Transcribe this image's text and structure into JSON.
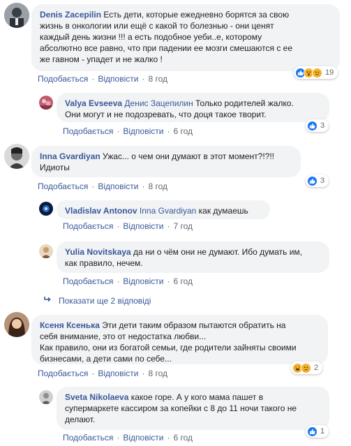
{
  "comments": [
    {
      "author": "Denis Zacepilin",
      "lines": [
        "Есть дети, которые ежедневно борятся за свою",
        "жизнь в онкологии или ещё с какой то болезнью - они ценят",
        "каждый день жизни !!! а есть подобное уеби..е, которому",
        "абсолютно все равно, что при падении ее мозги смешаются с ее",
        "же гавном - упадет и не жалко !"
      ],
      "like": "Подобається",
      "reply": "Відповісти",
      "time": "8 год",
      "reaction_count": "19"
    },
    {
      "author": "Valya Evseeva",
      "mention": "Денис Зацепилин",
      "lines": [
        " Только родителей жалко.",
        "Они могут и не подозревать, что доця такое творит."
      ],
      "like": "Подобається",
      "reply": "Відповісти",
      "time": "6 год",
      "reaction_count": "3"
    },
    {
      "author": "Inna Gvardiyan",
      "lines": [
        " Ужас... о чем они думают в этот момент?!?!!",
        "Идиоты"
      ],
      "like": "Подобається",
      "reply": "Відповісти",
      "time": "8 год",
      "reaction_count": "3"
    },
    {
      "author": "Vladislav Antonov",
      "mention": "Inna Gvardiyan",
      "lines": [
        " как думаешь"
      ],
      "like": "Подобається",
      "reply": "Відповісти",
      "time": "7 год"
    },
    {
      "author": "Yulia Novitskaya",
      "lines": [
        " да ни о чём они не думают. Ибо думать им,",
        "как правило, нечем."
      ],
      "like": "Подобається",
      "reply": "Відповісти",
      "time": "6 год"
    },
    {
      "author": "Ксеня Ксенька",
      "lines": [
        " Эти дети таким образом пытаются обратить на",
        "себя внимание, это от недостатка любви...",
        "Как правило, они из богатой семьи, где родители зайняты своими",
        "бизнесами, а дети сами по себе..."
      ],
      "like": "Подобається",
      "reply": "Відповісти",
      "time": "8 год",
      "reaction_count": "2"
    },
    {
      "author": "Sveta Nikolaeva",
      "lines": [
        " какое горе. А у кого мама пашет в",
        "супермаркете кассиром за копейки с 8 до 11 ночи такого не",
        "делают."
      ],
      "like": "Подобається",
      "reply": "Відповісти",
      "time": "6 год",
      "reaction_count": "1"
    }
  ],
  "show_more_replies": "Показати ще 2 відповіді",
  "colors": {
    "link": "#385898",
    "bubble": "#f2f3f5",
    "meta": "#616770",
    "like_blue": "#1877f2",
    "emoji_yellow": "#f7b125"
  }
}
